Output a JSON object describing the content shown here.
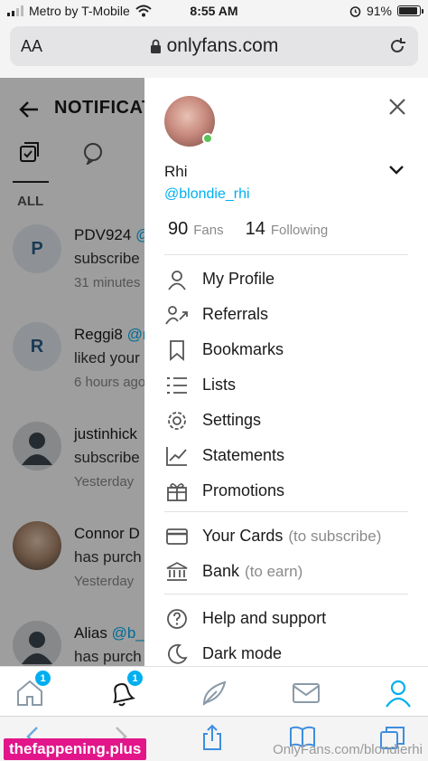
{
  "status_bar": {
    "carrier": "Metro by T-Mobile",
    "time": "8:55 AM",
    "battery": "91%",
    "battery_level": 0.91
  },
  "browser": {
    "aa_label": "AA",
    "url": "onlyfans.com"
  },
  "background_page": {
    "title": "NOTIFICAT",
    "filter_label": "ALL",
    "notifications": [
      {
        "initial": "P",
        "name": "PDV924",
        "handle": "@",
        "text": "subscribe",
        "time": "31 minutes"
      },
      {
        "initial": "R",
        "name": "Reggi8",
        "handle": "@r",
        "text": "liked your",
        "time": "6 hours ago"
      },
      {
        "initial": "",
        "name": "justinhick",
        "handle": "",
        "text": "subscribe",
        "time": "Yesterday"
      },
      {
        "initial": "",
        "name": "Connor D",
        "handle": "",
        "text": "has purch",
        "time": "Yesterday"
      },
      {
        "initial": "",
        "name": "Alias",
        "handle": "@b_",
        "text": "has purch",
        "time": ""
      }
    ]
  },
  "drawer": {
    "name": "Rhi",
    "handle": "@blondie_rhi",
    "fans_count": "90",
    "fans_label": "Fans",
    "following_count": "14",
    "following_label": "Following",
    "menu_primary": [
      {
        "label": "My Profile",
        "icon": "user-icon"
      },
      {
        "label": "Referrals",
        "icon": "referrals-icon"
      },
      {
        "label": "Bookmarks",
        "icon": "bookmark-icon"
      },
      {
        "label": "Lists",
        "icon": "list-icon"
      },
      {
        "label": "Settings",
        "icon": "gear-icon"
      },
      {
        "label": "Statements",
        "icon": "chart-icon"
      },
      {
        "label": "Promotions",
        "icon": "gift-icon"
      }
    ],
    "menu_payment": [
      {
        "label": "Your Cards",
        "sub": "(to subscribe)",
        "icon": "card-icon"
      },
      {
        "label": "Bank",
        "sub": "(to earn)",
        "icon": "bank-icon"
      }
    ],
    "menu_other": [
      {
        "label": "Help and support",
        "icon": "help-icon"
      },
      {
        "label": "Dark mode",
        "icon": "moon-icon"
      }
    ]
  },
  "bottom_nav": {
    "home_badge": "1",
    "notifications_badge": "1"
  },
  "watermarks": {
    "left": "thefappening.plus",
    "right": "OnlyFans.com/blondierhi"
  },
  "colors": {
    "accent": "#00aff0",
    "online": "#5cc257"
  }
}
